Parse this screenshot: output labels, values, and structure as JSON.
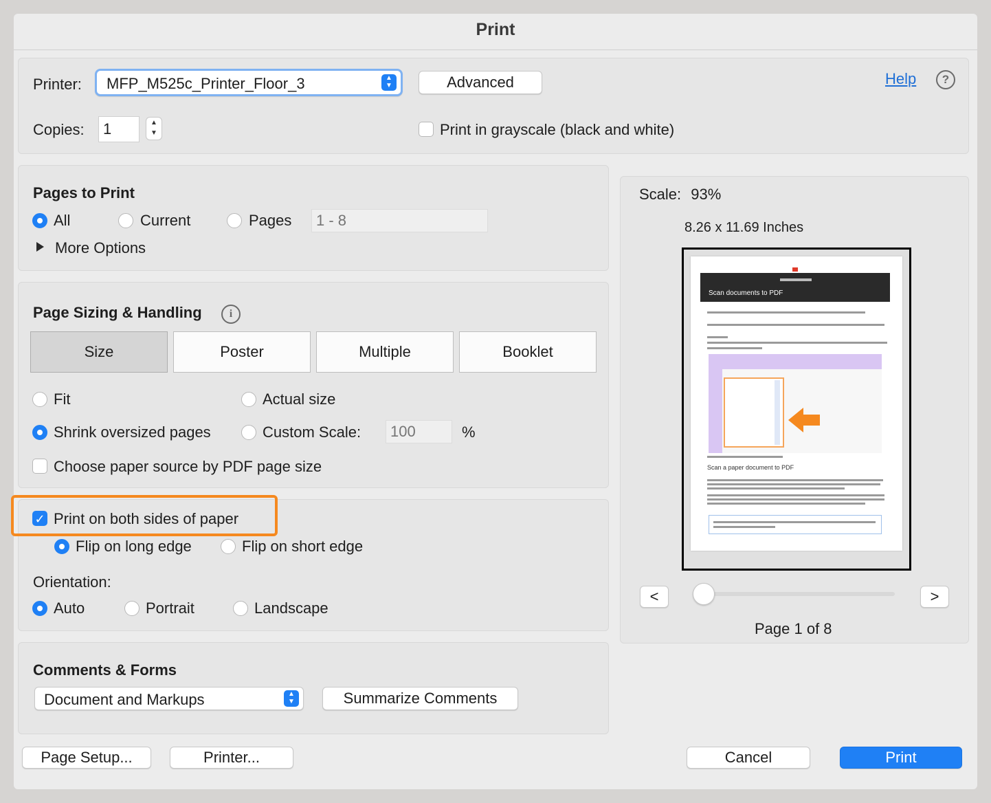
{
  "window": {
    "title": "Print"
  },
  "printer": {
    "label": "Printer:",
    "selected": "MFP_M525c_Printer_Floor_3",
    "advanced_label": "Advanced",
    "help_label": "Help",
    "help_icon": "question-circle-icon"
  },
  "copies": {
    "label": "Copies:",
    "value": "1",
    "grayscale_label": "Print in grayscale (black and white)",
    "grayscale_checked": false
  },
  "pages_to_print": {
    "title": "Pages to Print",
    "options": [
      "All",
      "Current",
      "Pages"
    ],
    "selected": "All",
    "range_placeholder": "1 - 8",
    "more_options": "More Options"
  },
  "page_sizing": {
    "title": "Page Sizing & Handling",
    "tabs": [
      "Size",
      "Poster",
      "Multiple",
      "Booklet"
    ],
    "active_tab": "Size",
    "fit": "Fit",
    "actual_size": "Actual size",
    "shrink": "Shrink oversized pages",
    "custom_scale": "Custom Scale:",
    "custom_scale_value": "100",
    "percent": "%",
    "selected": "Shrink oversized pages",
    "paper_source": "Choose paper source by PDF page size"
  },
  "duplex": {
    "label": "Print on both sides of paper",
    "checked": true,
    "flip_long": "Flip on long edge",
    "flip_short": "Flip on short edge",
    "flip_selected": "Flip on long edge",
    "highlight_color": "#f5891f"
  },
  "orientation": {
    "label": "Orientation:",
    "options": [
      "Auto",
      "Portrait",
      "Landscape"
    ],
    "selected": "Auto"
  },
  "comments": {
    "title": "Comments & Forms",
    "selected": "Document and Markups",
    "summarize_label": "Summarize Comments"
  },
  "preview": {
    "scale_label": "Scale:",
    "scale_value": "93%",
    "paper_size": "8.26 x 11.69 Inches",
    "page_status": "Page 1 of 8",
    "prev_label": "<",
    "next_label": ">",
    "doc_title": "Scan documents to PDF",
    "doc_heading": "Scan a paper document to PDF"
  },
  "footer": {
    "page_setup": "Page Setup...",
    "printer": "Printer...",
    "cancel": "Cancel",
    "print": "Print"
  },
  "colors": {
    "accent": "#1f80f5",
    "highlight": "#f5891f",
    "link": "#1f6fd6"
  }
}
